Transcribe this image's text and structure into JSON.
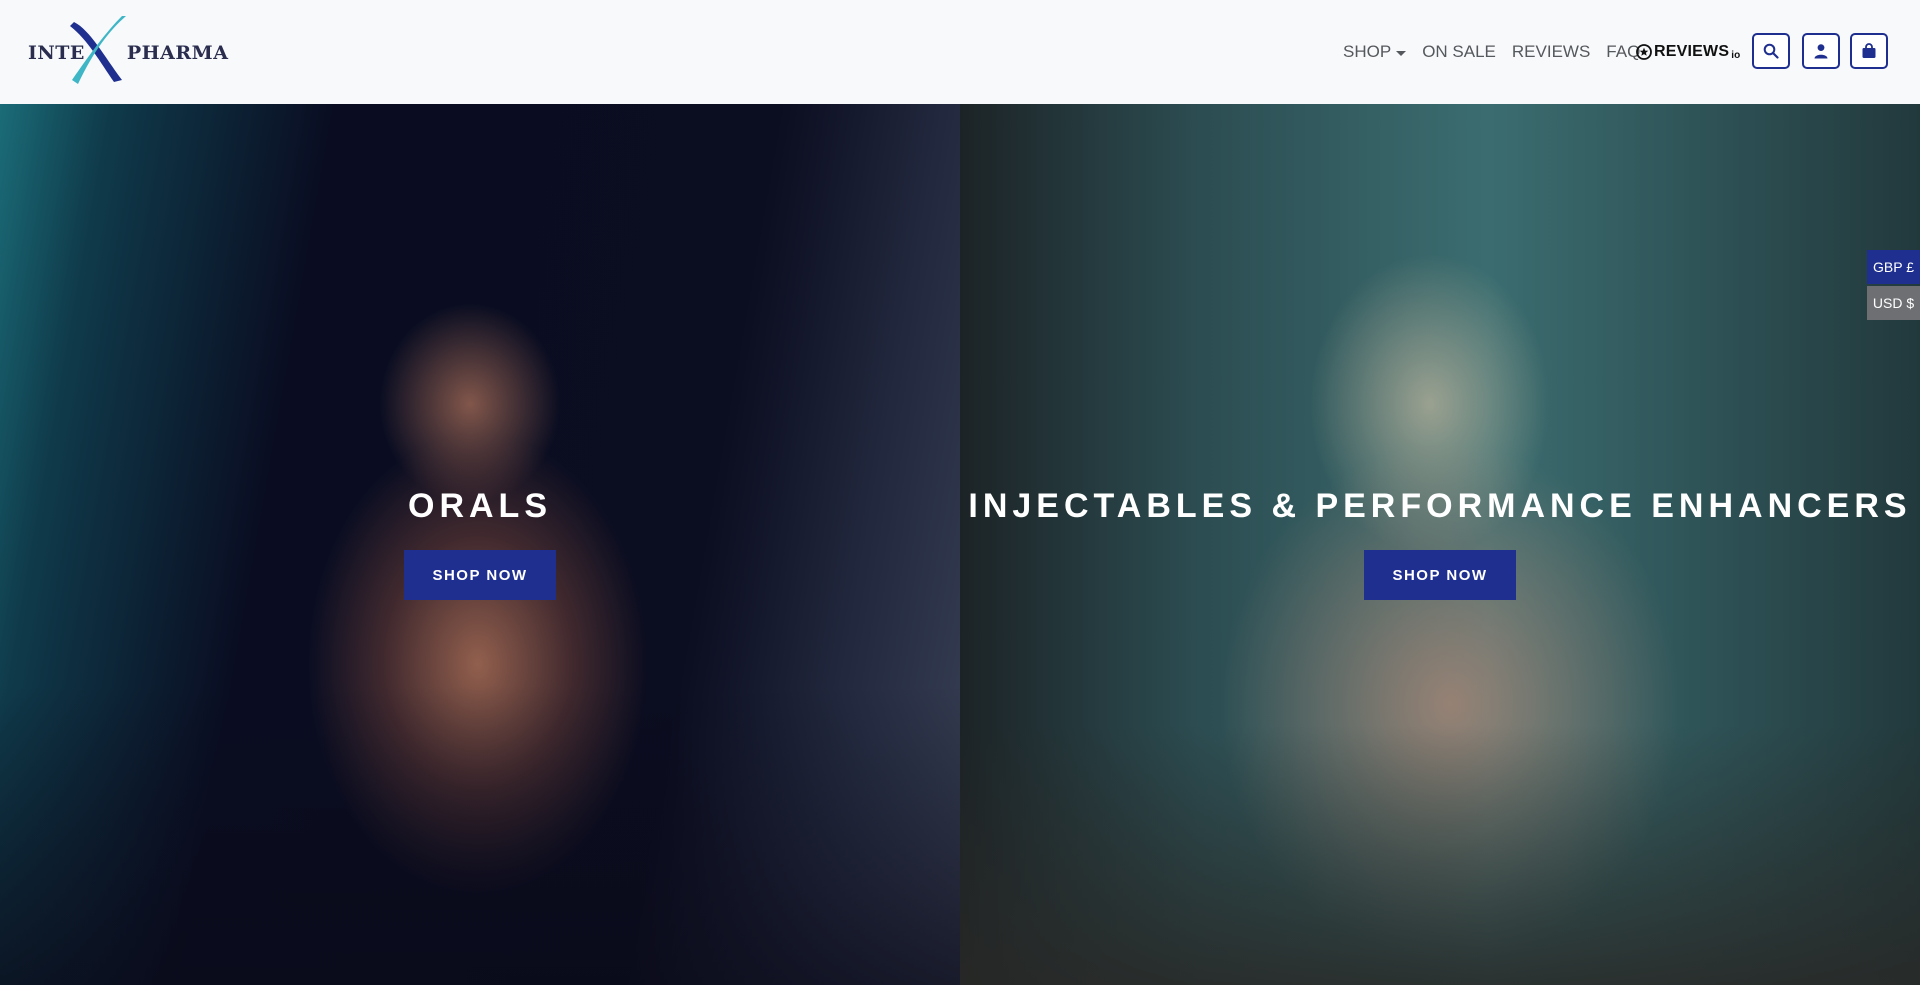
{
  "brand": {
    "logo_text_left": "INTE",
    "logo_text_right": "PHARMA",
    "logo_mark": "x-mark-icon",
    "logo_colors": [
      "#2a2d4e",
      "#1e2f8f",
      "#3fb6c6"
    ]
  },
  "nav": {
    "items": [
      {
        "label": "SHOP",
        "has_dropdown": true
      },
      {
        "label": "ON SALE"
      },
      {
        "label": "REVIEWS"
      },
      {
        "label": "FAQ"
      }
    ]
  },
  "reviews_badge": {
    "text": "REVIEWS",
    "suffix": "io",
    "icon": "star-circle-icon"
  },
  "header_actions": {
    "search_icon": "search-icon",
    "account_icon": "user-icon",
    "cart_icon": "shopping-bag-icon"
  },
  "hero": {
    "panels": [
      {
        "title": "ORALS",
        "cta": "SHOP NOW"
      },
      {
        "title": "INJECTABLES & PERFORMANCE ENHANCERS",
        "cta": "SHOP NOW"
      }
    ]
  },
  "currency": {
    "options": [
      {
        "label": "GBP £",
        "active": true
      },
      {
        "label": "USD $",
        "active": false
      }
    ]
  },
  "colors": {
    "accent": "#1e2f8f",
    "header_bg": "#f7f9fb",
    "currency_inactive": "#6d6f73"
  }
}
